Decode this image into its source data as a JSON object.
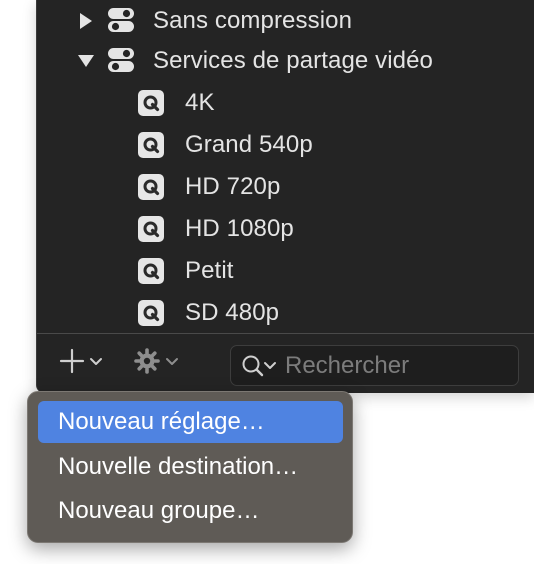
{
  "tree": {
    "groups": [
      {
        "label": "Sans compression",
        "expanded": false,
        "icon": "toggle-group-icon"
      },
      {
        "label": "Services de partage vidéo",
        "expanded": true,
        "icon": "toggle-group-icon"
      }
    ],
    "items": [
      {
        "label": "4K",
        "icon": "quicktime-icon"
      },
      {
        "label": "Grand 540p",
        "icon": "quicktime-icon"
      },
      {
        "label": "HD 720p",
        "icon": "quicktime-icon"
      },
      {
        "label": "HD 1080p",
        "icon": "quicktime-icon"
      },
      {
        "label": "Petit",
        "icon": "quicktime-icon"
      },
      {
        "label": "SD 480p",
        "icon": "quicktime-icon"
      }
    ]
  },
  "toolbar": {
    "add_icon": "plus-icon",
    "action_icon": "gear-icon",
    "search": {
      "placeholder": "Rechercher",
      "value": ""
    }
  },
  "menu": {
    "items": [
      {
        "label": "Nouveau réglage…",
        "selected": true
      },
      {
        "label": "Nouvelle destination…",
        "selected": false
      },
      {
        "label": "Nouveau groupe…",
        "selected": false
      }
    ]
  },
  "colors": {
    "panel_bg": "#242424",
    "menu_bg": "#5f5b56",
    "menu_highlight": "#4f83e1",
    "text": "#e4e4e4"
  }
}
